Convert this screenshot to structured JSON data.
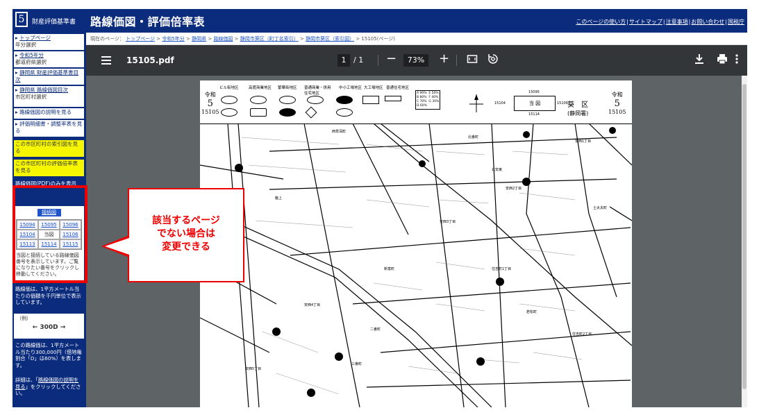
{
  "header": {
    "logo_number": "5",
    "subtitle": "財産評価基準書",
    "title": "路線価図・評価倍率表",
    "links": [
      "このページの使い方",
      "サイトマップ",
      "注意事項",
      "お問い合わせ",
      "国税庁"
    ]
  },
  "breadcrumb": {
    "prefix": "現在のページ：",
    "items": [
      "トップページ",
      "令和5年分",
      "静岡県",
      "路線価図",
      "静岡市葵区（町丁名索引）",
      "静岡市葵区（索引図）"
    ],
    "current": "15105(ページ)"
  },
  "sidebar": {
    "items": [
      {
        "link": "トップページ",
        "sub": "年分選択"
      },
      {
        "link": "令和5年分",
        "sub": "都道府県選択"
      },
      {
        "link": "静岡県 財産評価基準書目次",
        "sub": ""
      },
      {
        "link": "静岡県 路線価図目次",
        "sub": "市区町村選択"
      }
    ],
    "plain": [
      "路線価図の説明を見る",
      "評価明細書・調整率表を見る"
    ],
    "yellow": [
      "この市区町村の索引図を見る",
      "この市区町村の評価倍率表を見る"
    ],
    "navy_item": "路線価図(PDF)のみを表示",
    "adjacent": {
      "title": "接続図",
      "cells": [
        "15094",
        "15095",
        "15096",
        "15104",
        "当図",
        "15106",
        "15113",
        "15114",
        "15115"
      ],
      "note": "当図と接続している路線価図番号を表示しています。ご覧になりたい番号をクリックし移動してください。"
    },
    "unit_note": "路線価は、1平方メートル当たりの価額を千円単位で表示しています。",
    "example": {
      "label": "（例）",
      "value": "← 300D →"
    },
    "desc": "この路線価は、1平方メートル当たり300,000円（借地権割合「D」は60%）を表します。",
    "detail_pre": "詳細は、「",
    "detail_link": "路線価図の説明を見る",
    "detail_post": "」をクリックしてください。"
  },
  "pdf": {
    "filename": "15105.pdf",
    "page_current": "1",
    "page_sep": "/",
    "page_total": "1",
    "zoom": "73%",
    "header": {
      "reiwa": "令和",
      "year": "5",
      "number": "15105",
      "ward": "葵　区",
      "tax_office": "(静岡署)",
      "center_map": "当 図",
      "adjacent_left": "15104",
      "adjacent_right": "15106",
      "adjacent_top": "15095",
      "adjacent_bottom": "15114",
      "legend": [
        "ビル街地区",
        "高度商業地区",
        "繁華街地区",
        "普通商業・併用住宅地区",
        "中小工場地区",
        "大工場地区",
        "普通住宅地区"
      ]
    },
    "map_labels": [
      "北番町",
      "安西1丁目",
      "安西2丁目",
      "安西3丁目",
      "安西4丁目",
      "安西5丁目",
      "北安東",
      "住吉町1丁目",
      "住吉町2丁目",
      "二番町",
      "三番町",
      "土太夫町",
      "籠上",
      "西草深町",
      "若松町",
      "新富町"
    ]
  },
  "callout": {
    "line1": "該当するページ",
    "line2": "でない場合は",
    "line3": "変更できる"
  }
}
